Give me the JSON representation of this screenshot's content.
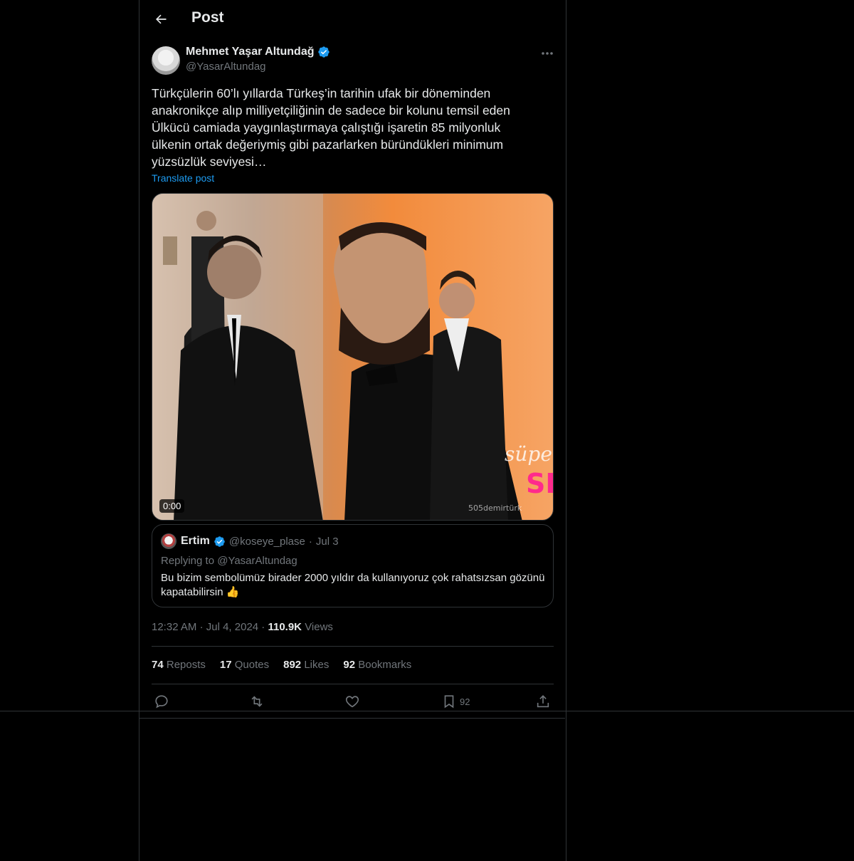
{
  "header": {
    "title": "Post"
  },
  "author": {
    "name": "Mehmet Yaşar Altundağ",
    "handle": "@YasarAltundag"
  },
  "tweet": {
    "text": "Türkçülerin 60’lı yıllarda Türkeş’in tarihin ufak bir döneminden anakronikçe alıp milliyetçiliğinin de sadece bir kolunu temsil eden Ülkücü camiada yaygınlaştırmaya çalıştığı işaretin 85 milyonluk ülkenin ortak değeriymiş gibi pazarlarken büründükleri minimum yüzsüzlük seviyesi…",
    "translate_label": "Translate post",
    "video_timecode": "0:00"
  },
  "quote": {
    "name": "Ertim",
    "handle": "@koseye_plase",
    "separator": "·",
    "date": "Jul 3",
    "replying": "Replying to @YasarAltundag",
    "text": "Bu bizim sembolümüz birader 2000 yıldır da kullanıyoruz çok rahatsızsan gözünü kapatabilirsin 👍"
  },
  "meta": {
    "time": "12:32 AM",
    "sep1": "·",
    "date": "Jul 4, 2024",
    "sep2": "·",
    "views_count": "110.9K",
    "views_label": "Views"
  },
  "stats": {
    "reposts_count": "74",
    "reposts_label": "Reposts",
    "quotes_count": "17",
    "quotes_label": "Quotes",
    "likes_count": "892",
    "likes_label": "Likes",
    "bookmarks_count": "92",
    "bookmarks_label": "Bookmarks"
  },
  "actions": {
    "bookmark_count": "92"
  },
  "icons": {
    "back": "arrow-left-icon",
    "verified": "verified-badge-icon",
    "more": "more-horizontal-icon",
    "reply": "reply-icon",
    "repost": "repost-icon",
    "like": "heart-icon",
    "bookmark": "bookmark-icon",
    "share": "share-icon"
  },
  "colors": {
    "accent": "#1d9bf0",
    "background": "#000000",
    "border": "#2f3336",
    "muted": "#71767b",
    "text": "#e7e9ea"
  }
}
